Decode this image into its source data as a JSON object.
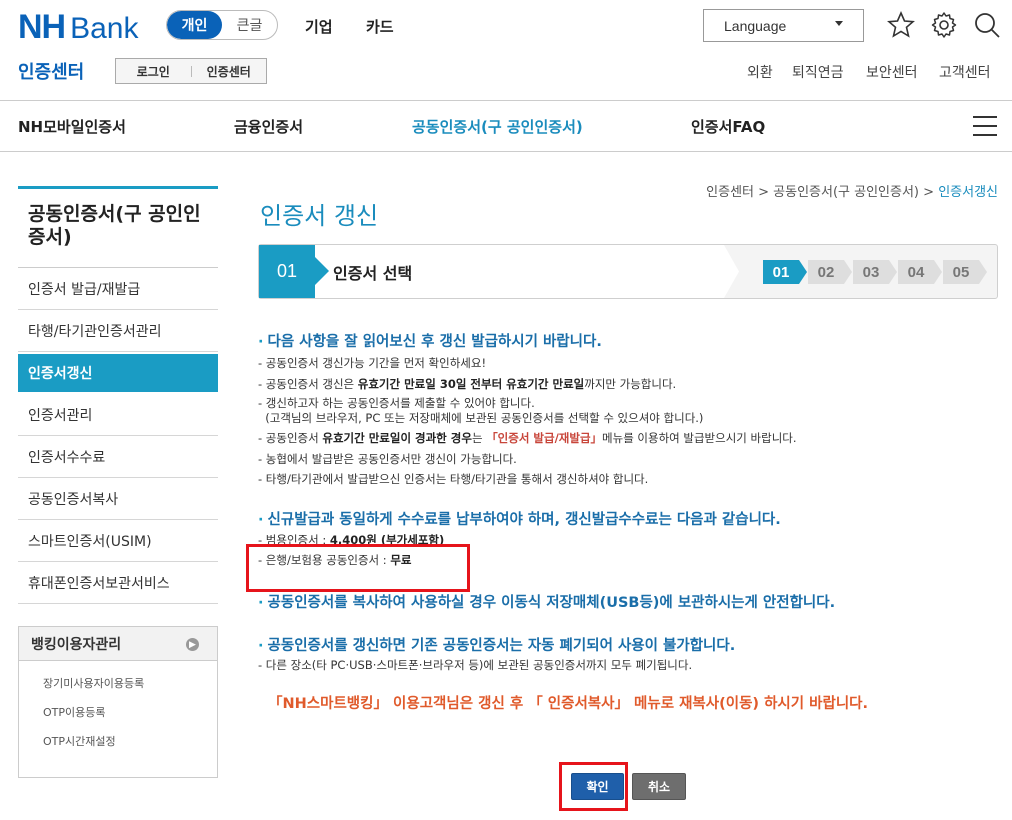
{
  "header": {
    "logo_nh": "NH",
    "logo_bank": "Bank",
    "segment": [
      "개인",
      "큰글"
    ],
    "nav": [
      "기업",
      "카드"
    ],
    "language_label": "Language",
    "center_title": "인증센터",
    "crumb_buttons": [
      "로그인",
      "인증센터"
    ],
    "util_links": [
      "외환",
      "퇴직연금",
      "보안센터",
      "고객센터"
    ],
    "icons": [
      "star-icon",
      "gear-icon",
      "search-icon",
      "menu-icon"
    ]
  },
  "gnb": [
    "NH모바일인증서",
    "금융인증서",
    "공동인증서(구 공인인증서)",
    "인증서FAQ"
  ],
  "sidebar": {
    "title": "공동인증서(구 공인인증서)",
    "items": [
      "인증서 발급/재발급",
      "타행/타기관인증서관리",
      "인증서갱신",
      "인증서관리",
      "인증서수수료",
      "공동인증서복사",
      "스마트인증서(USIM)",
      "휴대폰인증서보관서비스"
    ],
    "bank_box": {
      "title": "뱅킹이용자관리",
      "links": [
        "장기미사용자이용등록",
        "OTP이용등록",
        "OTP시간재설정"
      ]
    }
  },
  "breadcrumb": [
    "인증센터",
    "공동인증서(구 공인인증서)",
    "인증서갱신"
  ],
  "page_title": "인증서 갱신",
  "step": {
    "num": "01",
    "label": "인증서 선택",
    "steps": [
      "01",
      "02",
      "03",
      "04",
      "05"
    ]
  },
  "notice1": {
    "heading": "다음 사항을 잘 읽어보신 후 갱신 발급하시기 바랍니다.",
    "l1": "- 공동인증서 갱신가능 기간을 먼저 확인하세요!",
    "l2a": "- 공동인증서 갱신은 ",
    "l2b": "유효기간 만료일 30일 전부터 유효기간 만료일",
    "l2c": "까지만 가능합니다.",
    "l3": "- 갱신하고자 하는 공동인증서를 제출할 수 있어야 합니다.",
    "l4": "  (고객님의 브라우저, PC 또는 저장매체에 보관된 공동인증서를 선택할 수 있으셔야 합니다.)",
    "l5a": "- 공동인증서 ",
    "l5b": "유효기간 만료일이 경과한 경우",
    "l5c": "는 ",
    "l5d": "「인증서 발급/재발급」",
    "l5e": "메뉴를 이용하여 발급받으시기 바랍니다.",
    "l6": "- 농협에서 발급받은 공동인증서만 갱신이 가능합니다.",
    "l7": "- 타행/타기관에서 발급받으신 인증서는 타행/타기관을 통해서 갱신하셔야 합니다."
  },
  "notice2": {
    "heading": "신규발급과 동일하게 수수료를 납부하여야 하며, 갱신발급수수료는 다음과 같습니다.",
    "f1a": "- 범용인증서 : ",
    "f1b": "4,400원 (부가세포함)",
    "f2a": "- 은행/보험용 공동인증서 : ",
    "f2b": "무료"
  },
  "notice3": {
    "heading": "공동인증서를 복사하여 사용하실 경우 이동식 저장매체(USB등)에 보관하시는게 안전합니다."
  },
  "notice4": {
    "heading": "공동인증서를 갱신하면 기존 공동인증서는 자동 폐기되어 사용이 불가합니다.",
    "l1": "- 다른 장소(타 PC·USB·스마트폰·브라우저 등)에 보관된 공동인증서까지 모두 폐기됩니다."
  },
  "warning": "「NH스마트뱅킹」 이용고객님은 갱신 후 「 인증서복사」 메뉴로 재복사(이동) 하시기 바랍니다.",
  "buttons": {
    "ok": "확인",
    "cancel": "취소"
  },
  "colors": {
    "brand": "#0a62b8",
    "accent": "#1a9cc4",
    "warning": "#e05a2b",
    "highlight_box": "#e6141b"
  }
}
